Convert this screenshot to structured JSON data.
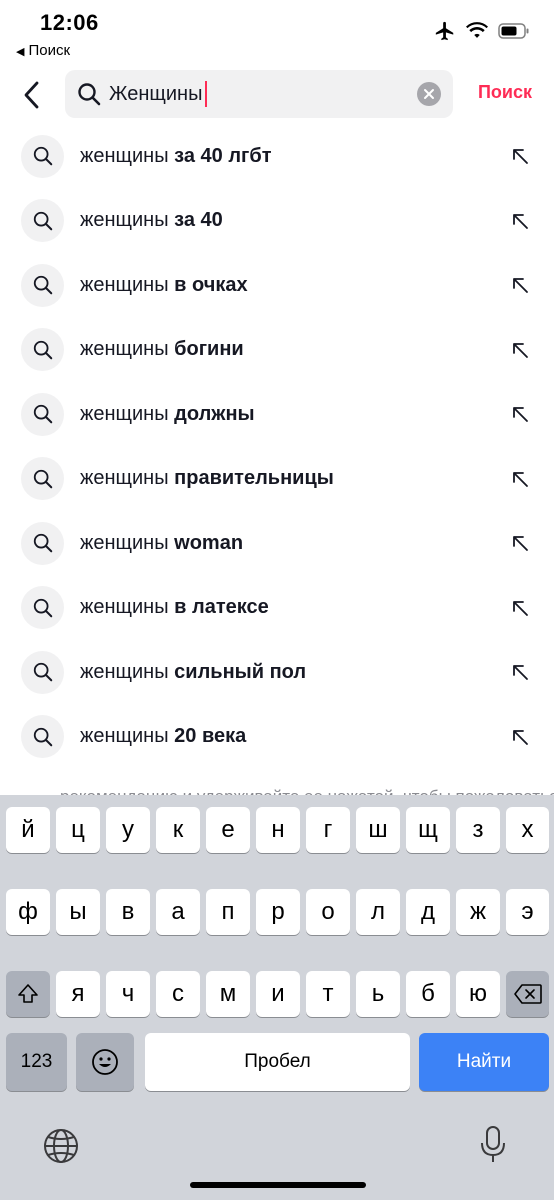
{
  "status": {
    "time": "12:06",
    "back_label": "Поиск"
  },
  "header": {
    "query": "Женщины",
    "submit_label": "Поиск"
  },
  "suggestions": [
    {
      "prefix": "женщины",
      "suffix": "за 40 лгбт"
    },
    {
      "prefix": "женщины",
      "suffix": "за 40"
    },
    {
      "prefix": "женщины",
      "suffix": "в очках"
    },
    {
      "prefix": "женщины",
      "suffix": "богини"
    },
    {
      "prefix": "женщины",
      "suffix": "должны"
    },
    {
      "prefix": "женщины",
      "suffix": "правительницы"
    },
    {
      "prefix": "женщины",
      "suffix": "woman"
    },
    {
      "prefix": "женщины",
      "suffix": "в латексе"
    },
    {
      "prefix": "женщины",
      "suffix": "сильный пол"
    },
    {
      "prefix": "женщины",
      "suffix": "20 века"
    }
  ],
  "background_text": "рекомендацию и удерживайте ее нажатой, чтобы пожаловаться",
  "keyboard": {
    "row1": [
      "й",
      "ц",
      "у",
      "к",
      "е",
      "н",
      "г",
      "ш",
      "щ",
      "з",
      "х"
    ],
    "row2": [
      "ф",
      "ы",
      "в",
      "а",
      "п",
      "р",
      "о",
      "л",
      "д",
      "ж",
      "э"
    ],
    "row3": [
      "я",
      "ч",
      "с",
      "м",
      "и",
      "т",
      "ь",
      "б",
      "ю"
    ],
    "numbers_label": "123",
    "space_label": "Пробел",
    "action_label": "Найти"
  },
  "colors": {
    "accent": "#fe2c55",
    "keyboard_bg": "#d1d4da",
    "action_key": "#3c82f6"
  }
}
